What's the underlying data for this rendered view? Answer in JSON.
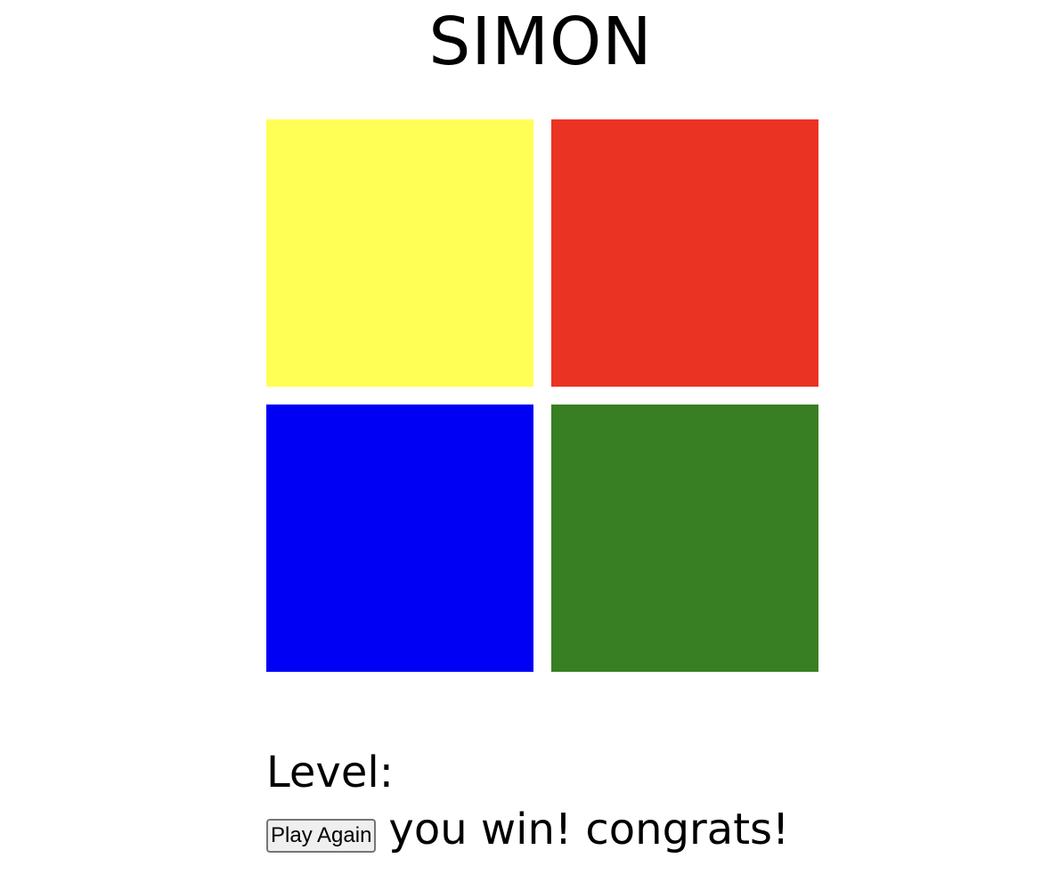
{
  "game": {
    "title": "SIMON",
    "pads": [
      {
        "name": "yellow",
        "color": "#ffff55"
      },
      {
        "name": "red",
        "color": "#ea3323"
      },
      {
        "name": "blue",
        "color": "#0000f5"
      },
      {
        "name": "green",
        "color": "#387e22"
      }
    ],
    "level_label": "Level:",
    "play_again_label": "Play Again",
    "message": "you win! congrats!"
  }
}
